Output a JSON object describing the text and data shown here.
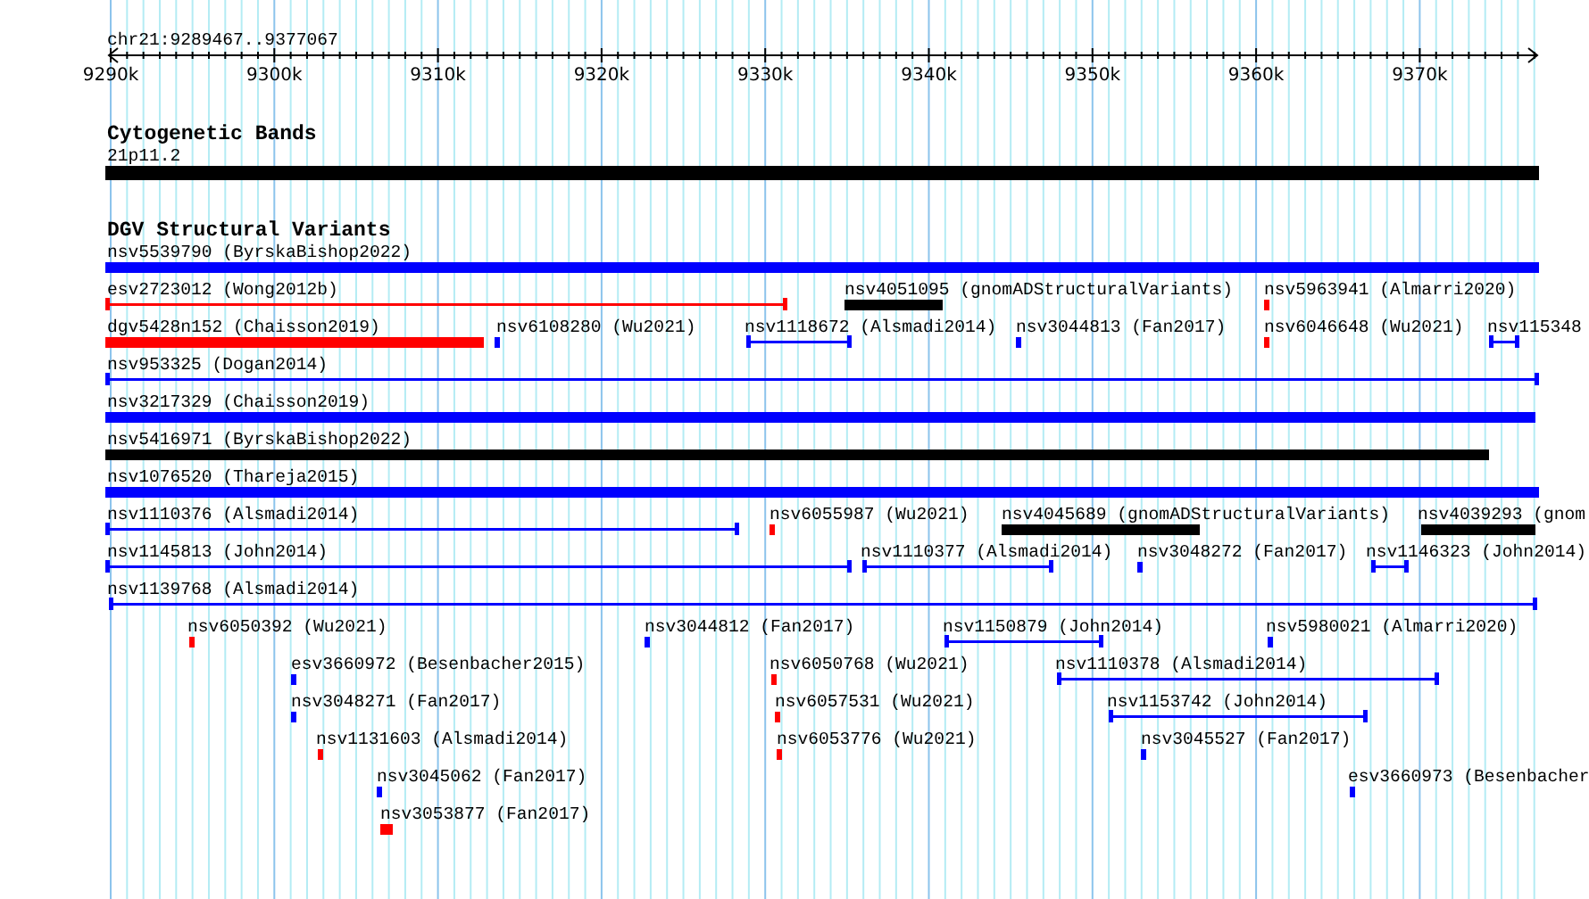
{
  "position": "chr21:9289467..9377067",
  "ruler": {
    "ticks": [
      "9290k",
      "9300k",
      "9310k",
      "9320k",
      "9330k",
      "9340k",
      "9350k",
      "9360k",
      "9370k"
    ]
  },
  "tracks": [
    {
      "title": "Cytogenetic Bands",
      "rows": [
        {
          "features": [
            {
              "label": "21p11.2",
              "kind": "bar",
              "color": "#000000"
            }
          ]
        }
      ]
    },
    {
      "title": "DGV Structural Variants",
      "rows": [
        {
          "features": [
            {
              "label": "nsv5539790 (ByrskaBishop2022)",
              "kind": "bar",
              "color": "#0000ff"
            }
          ]
        },
        {
          "features": [
            {
              "label": "esv2723012 (Wong2012b)",
              "kind": "span",
              "color": "#ff0000"
            },
            {
              "label": "nsv4051095 (gnomADStructuralVariants)",
              "kind": "bar",
              "color": "#000000"
            },
            {
              "label": "nsv5963941 (Almarri2020)",
              "kind": "mark",
              "color": "#ff0000"
            }
          ]
        },
        {
          "features": [
            {
              "label": "dgv5428n152 (Chaisson2019)",
              "kind": "bar",
              "color": "#ff0000"
            },
            {
              "label": "nsv6108280 (Wu2021)",
              "kind": "mark",
              "color": "#0000ff"
            },
            {
              "label": "nsv1118672 (Alsmadi2014)",
              "kind": "span",
              "color": "#0000ff"
            },
            {
              "label": "nsv3044813 (Fan2017)",
              "kind": "mark",
              "color": "#0000ff"
            },
            {
              "label": "nsv6046648 (Wu2021)",
              "kind": "mark",
              "color": "#ff0000"
            },
            {
              "label": "nsv115348",
              "kind": "span",
              "color": "#0000ff"
            }
          ]
        },
        {
          "features": [
            {
              "label": "nsv953325 (Dogan2014)",
              "kind": "span",
              "color": "#0000ff"
            }
          ]
        },
        {
          "features": [
            {
              "label": "nsv3217329 (Chaisson2019)",
              "kind": "bar",
              "color": "#0000ff"
            }
          ]
        },
        {
          "features": [
            {
              "label": "nsv5416971 (ByrskaBishop2022)",
              "kind": "bar",
              "color": "#000000"
            }
          ]
        },
        {
          "features": [
            {
              "label": "nsv1076520 (Thareja2015)",
              "kind": "bar",
              "color": "#0000ff"
            }
          ]
        },
        {
          "features": [
            {
              "label": "nsv1110376 (Alsmadi2014)",
              "kind": "span",
              "color": "#0000ff"
            },
            {
              "label": "nsv6055987 (Wu2021)",
              "kind": "mark",
              "color": "#ff0000"
            },
            {
              "label": "nsv4045689 (gnomADStructuralVariants)",
              "kind": "bar",
              "color": "#000000"
            },
            {
              "label": "nsv4039293 (gnom",
              "kind": "bar",
              "color": "#000000"
            }
          ]
        },
        {
          "features": [
            {
              "label": "nsv1145813 (John2014)",
              "kind": "span",
              "color": "#0000ff"
            },
            {
              "label": "nsv1110377 (Alsmadi2014)",
              "kind": "span",
              "color": "#0000ff"
            },
            {
              "label": "nsv3048272 (Fan2017)",
              "kind": "mark",
              "color": "#0000ff"
            },
            {
              "label": "nsv1146323 (John2014)",
              "kind": "span",
              "color": "#0000ff"
            }
          ]
        },
        {
          "features": [
            {
              "label": "nsv1139768 (Alsmadi2014)",
              "kind": "span",
              "color": "#0000ff"
            }
          ]
        },
        {
          "features": [
            {
              "label": "nsv6050392 (Wu2021)",
              "kind": "mark",
              "color": "#ff0000"
            },
            {
              "label": "nsv3044812 (Fan2017)",
              "kind": "mark",
              "color": "#0000ff"
            },
            {
              "label": "nsv1150879 (John2014)",
              "kind": "span",
              "color": "#0000ff"
            },
            {
              "label": "nsv5980021 (Almarri2020)",
              "kind": "mark",
              "color": "#0000ff"
            }
          ]
        },
        {
          "features": [
            {
              "label": "esv3660972 (Besenbacher2015)",
              "kind": "mark",
              "color": "#0000ff"
            },
            {
              "label": "nsv6050768 (Wu2021)",
              "kind": "mark",
              "color": "#ff0000"
            },
            {
              "label": "nsv1110378 (Alsmadi2014)",
              "kind": "span",
              "color": "#0000ff"
            }
          ]
        },
        {
          "features": [
            {
              "label": "nsv3048271 (Fan2017)",
              "kind": "mark",
              "color": "#0000ff"
            },
            {
              "label": "nsv6057531 (Wu2021)",
              "kind": "mark",
              "color": "#ff0000"
            },
            {
              "label": "nsv1153742 (John2014)",
              "kind": "span",
              "color": "#0000ff"
            }
          ]
        },
        {
          "features": [
            {
              "label": "nsv1131603 (Alsmadi2014)",
              "kind": "mark",
              "color": "#ff0000"
            },
            {
              "label": "nsv6053776 (Wu2021)",
              "kind": "mark",
              "color": "#ff0000"
            },
            {
              "label": "nsv3045527 (Fan2017)",
              "kind": "mark",
              "color": "#0000ff"
            }
          ]
        },
        {
          "features": [
            {
              "label": "nsv3045062 (Fan2017)",
              "kind": "mark",
              "color": "#0000ff"
            },
            {
              "label": "esv3660973 (Besenbacher",
              "kind": "mark",
              "color": "#0000ff"
            }
          ]
        },
        {
          "features": [
            {
              "label": "nsv3053877 (Fan2017)",
              "kind": "bar",
              "color": "#ff0000"
            }
          ]
        }
      ]
    }
  ]
}
